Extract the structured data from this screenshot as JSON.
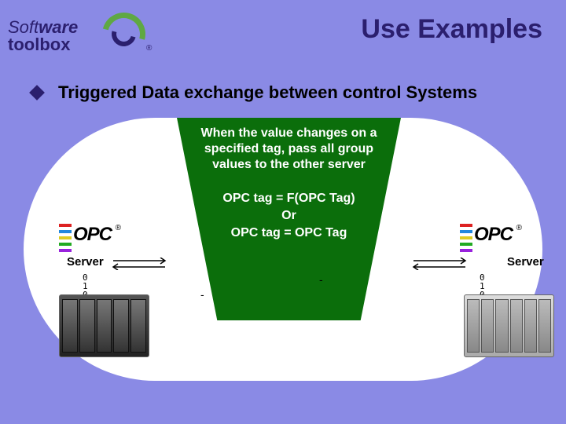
{
  "title": "Use Examples",
  "logo": {
    "line1a": "Soft",
    "line1b": "ware",
    "line2": "toolbox",
    "reg": "®"
  },
  "bullet": "Triggered Data exchange between control Systems",
  "trapezoid": {
    "top": "When the value changes on a specified tag, pass all group values to the other server",
    "eq1": "OPC tag = F(OPC Tag)",
    "or": "Or",
    "eq2": "OPC tag = OPC Tag"
  },
  "dash": "-",
  "server_label": "Server",
  "opc": {
    "text": "OPC",
    "reg": "®"
  },
  "binary_l": "0\n1\n0\n1",
  "binary_r": "0\n1\n0\n1\n0\n1"
}
